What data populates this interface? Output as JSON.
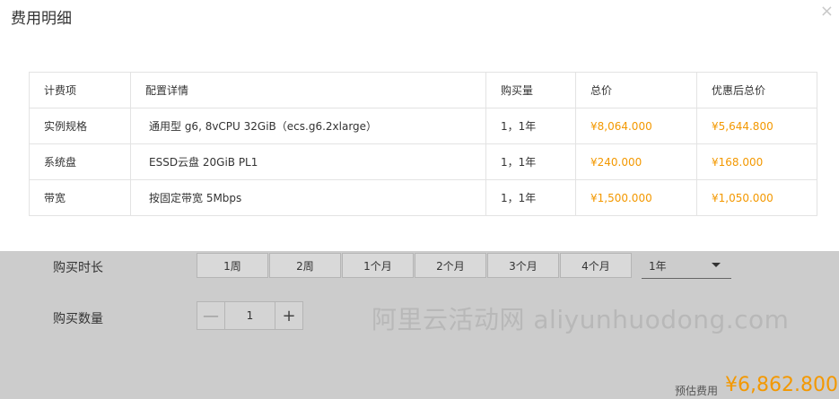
{
  "modal": {
    "title": "费用明细",
    "close_glyph": "×",
    "table": {
      "headers": [
        "计费项",
        "配置详情",
        "购买量",
        "总价",
        "优惠后总价"
      ],
      "rows": [
        {
          "item": "实例规格",
          "detail": "通用型 g6, 8vCPU 32GiB（ecs.g6.2xlarge）",
          "qty": "1，1年",
          "total": "¥8,064.000",
          "discounted": "¥5,644.800"
        },
        {
          "item": "系统盘",
          "detail": "ESSD云盘 20GiB PL1",
          "qty": "1，1年",
          "total": "¥240.000",
          "discounted": "¥168.000"
        },
        {
          "item": "带宽",
          "detail": "按固定带宽 5Mbps",
          "qty": "1，1年",
          "total": "¥1,500.000",
          "discounted": "¥1,050.000"
        }
      ]
    }
  },
  "background": {
    "duration_label": "购买时长",
    "duration_options": [
      "1周",
      "2周",
      "1个月",
      "2个月",
      "3个月",
      "4个月"
    ],
    "year_select_value": "1年",
    "quantity_label": "购买数量",
    "quantity_value": "1",
    "minus_glyph": "—",
    "plus_glyph": "+",
    "watermark": "阿里云活动网 aliyunhuodong.com",
    "estimate_label": "预估费用",
    "estimate_price": "¥6,862.800"
  },
  "colors": {
    "price": "#f39800",
    "overlay": "#cccccc"
  }
}
